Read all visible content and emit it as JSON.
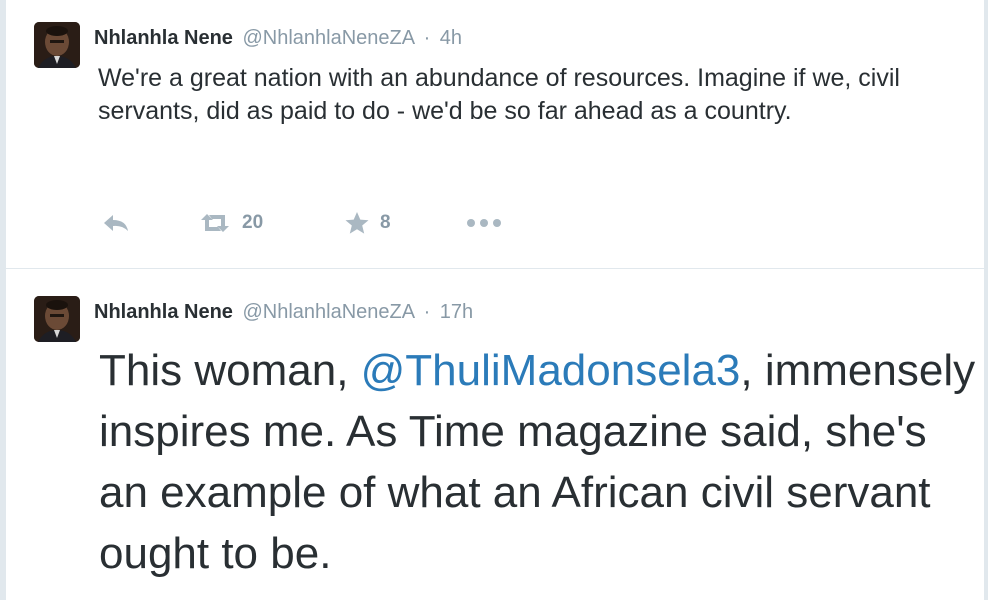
{
  "tweets": [
    {
      "fullname": "Nhlanhla Nene",
      "username": "@NhlanhlaNeneZA",
      "separator": "·",
      "time": "4h",
      "text": "We're a great nation with an abundance of resources. Imagine if we, civil servants, did as paid to do - we'd be so far ahead as a country.",
      "retweets": "20",
      "favorites": "8"
    },
    {
      "fullname": "Nhlanhla Nene",
      "username": "@NhlanhlaNeneZA",
      "separator": "·",
      "time": "17h",
      "text_before": "This woman, ",
      "mention": "@ThuliMadonsela3",
      "text_after": ", immensely inspires me. As Time magazine said, she's an example of what an African civil servant ought to be."
    }
  ],
  "colors": {
    "text": "#292f33",
    "muted": "#8899a6",
    "icon": "#aab8c2",
    "link": "#2b7bb9",
    "divider": "#e1e8ed"
  },
  "icons": [
    "reply-icon",
    "retweet-icon",
    "favorite-star-icon",
    "more-dots-icon"
  ]
}
